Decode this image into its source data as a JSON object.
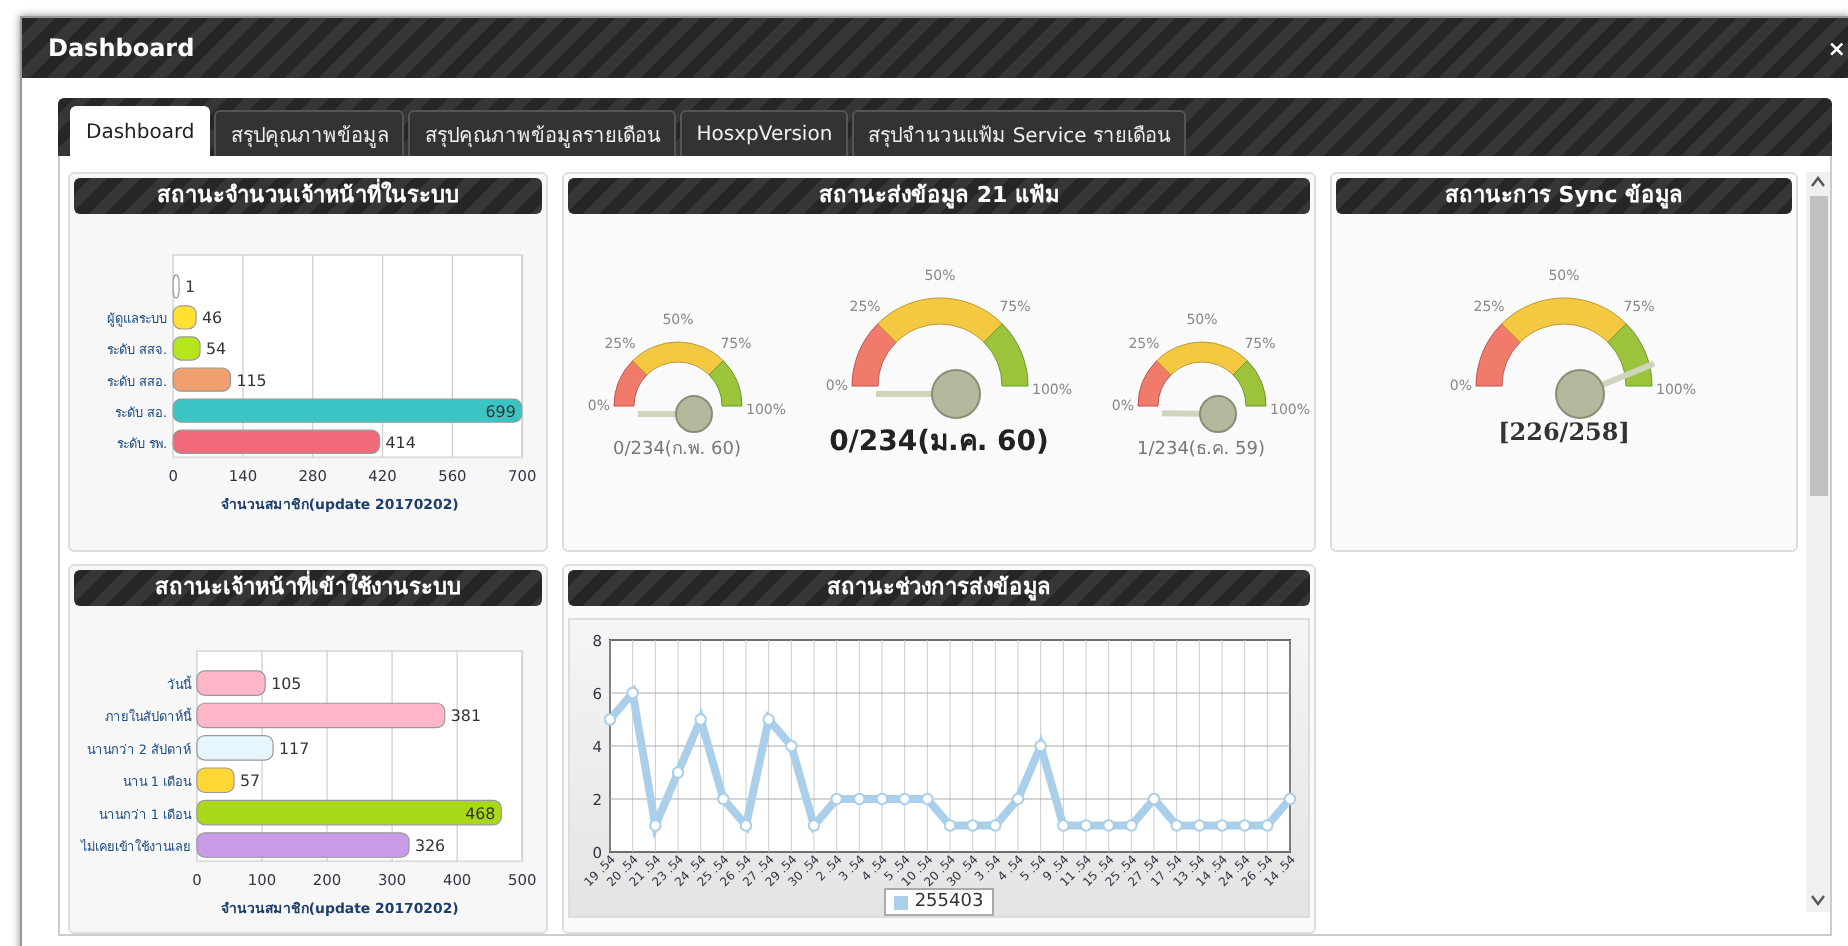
{
  "window": {
    "title": "Dashboard",
    "close": "×"
  },
  "tabs": [
    {
      "label": "Dashboard",
      "selected": true
    },
    {
      "label": "สรุปคุณภาพข้อมูล",
      "selected": false
    },
    {
      "label": "สรุปคุณภาพข้อมูลรายเดือน",
      "selected": false
    },
    {
      "label": "HosxpVersion",
      "selected": false
    },
    {
      "label": "สรุปจำนวนแฟ้ม Service รายเดือน",
      "selected": false
    }
  ],
  "staff_panel": {
    "title": "สถานะจำนวนเจ้าหน้าที่ในระบบ",
    "chart_data": {
      "type": "bar",
      "orientation": "horizontal",
      "xlabel": "จำนวนสมาชิก(update 20170202)",
      "categories": [
        null,
        "ผู้ดูแลระบบ",
        "ระดับ สสจ.",
        "ระดับ สสอ.",
        "ระดับ สอ.",
        "ระดับ รพ."
      ],
      "values": [
        1,
        46,
        54,
        115,
        699,
        414
      ],
      "colors": [
        "#ffffff",
        "#ffe033",
        "#b5e61d",
        "#f0a070",
        "#3cc4c4",
        "#f06a7a"
      ],
      "xlim": [
        0,
        700
      ],
      "xticks": [
        0,
        140,
        280,
        420,
        560,
        700
      ],
      "grid": true,
      "data_labels": true
    }
  },
  "send_panel": {
    "title": "สถานะส่งข้อมูล 21 แฟ้ม",
    "gauges": [
      {
        "label": "0/234(ก.พ. 60)",
        "primary": false,
        "ticks": [
          "0%",
          "25%",
          "50%",
          "75%",
          "100%"
        ]
      },
      {
        "label": "0/234(ม.ค. 60)",
        "primary": true,
        "ticks": [
          "0%",
          "25%",
          "50%",
          "75%",
          "100%"
        ]
      },
      {
        "label": "1/234(ธ.ค. 59)",
        "primary": false,
        "ticks": [
          "0%",
          "25%",
          "50%",
          "75%",
          "100%"
        ]
      }
    ]
  },
  "sync_panel": {
    "title": "สถานะการ Sync ข้อมูล",
    "gauges": [
      {
        "label": "[226/258]",
        "primary": true,
        "ticks": [
          "0%",
          "25%",
          "50%",
          "75%",
          "100%"
        ]
      }
    ]
  },
  "login_panel": {
    "title": "สถานะเจ้าหน้าที่เข้าใช้งานระบบ",
    "chart_data": {
      "type": "bar",
      "orientation": "horizontal",
      "xlabel": "จำนวนสมาชิก(update 20170202)",
      "categories": [
        "วันนี้",
        "ภายในสัปดาห์นี้",
        "นานกว่า 2 สัปดาห์",
        "นาน 1 เดือน",
        "นานกว่า 1 เดือน",
        "ไม่เคยเข้าใช้งานเลย"
      ],
      "values": [
        105,
        381,
        117,
        57,
        468,
        326
      ],
      "colors": [
        "#ffb6c8",
        "#ffb6c8",
        "#e6f6ff",
        "#ffd633",
        "#a8d81a",
        "#c99ae8"
      ],
      "xlim": [
        0,
        500
      ],
      "xticks": [
        0,
        100,
        200,
        300,
        400,
        500
      ],
      "grid": true,
      "data_labels": true
    }
  },
  "interval_panel": {
    "title": "สถานะช่วงการส่งข้อมูล",
    "chart_data": {
      "type": "line",
      "categories": [
        "19 .54",
        "20 .54",
        "21 .54",
        "23 .54",
        "24 .54",
        "25 .54",
        "26 .54",
        "27 .54",
        "29 .54",
        "30 .54",
        "2 .54",
        "3 .54",
        "4 .54",
        "5 .54",
        "10 .54",
        "20 .54",
        "30 .54",
        "3 .54",
        "4 .54",
        "5 .54",
        "9 .54",
        "11 .54",
        "15 .54",
        "25 .54",
        "27 .54",
        "17 .54",
        "13 .54",
        "14 .54",
        "24 .54",
        "26 .54",
        "14 .54"
      ],
      "series": [
        {
          "name": "255403",
          "color": "#a9cfea",
          "marker": true,
          "values": [
            5,
            6,
            1,
            3,
            5,
            2,
            1,
            5,
            4,
            1,
            2,
            2,
            2,
            2,
            2,
            1,
            1,
            1,
            2,
            4,
            1,
            1,
            1,
            1,
            2,
            1,
            1,
            1,
            1,
            1,
            2
          ]
        }
      ],
      "ylim": [
        0,
        8
      ],
      "yticks": [
        0,
        2,
        4,
        6,
        8
      ],
      "grid": true
    }
  }
}
